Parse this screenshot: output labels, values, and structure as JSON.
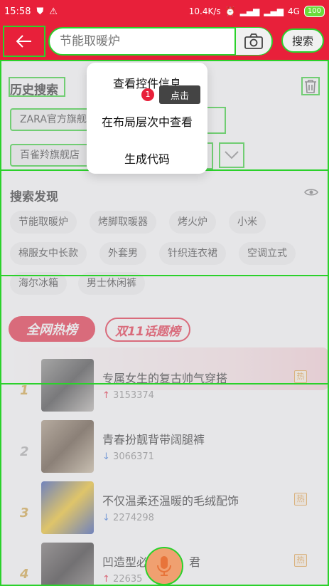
{
  "status": {
    "time": "15:58",
    "network_speed": "10.4K/s",
    "network_type": "4G",
    "battery": "100"
  },
  "header": {
    "search_placeholder": "节能取暖炉",
    "search_button": "搜索"
  },
  "history": {
    "title": "历史搜索",
    "items": [
      "ZARA官方旗舰店",
      "百雀羚旗舰店"
    ]
  },
  "discover": {
    "title": "搜索发现",
    "items": [
      "节能取暖炉",
      "烤脚取暖器",
      "烤火炉",
      "小米",
      "棉服女中长款",
      "外套男",
      "针织连衣裙",
      "空调立式",
      "海尔冰箱",
      "男士休闲裤"
    ]
  },
  "tabs": {
    "hot": "全网热榜",
    "topic": "双11话题榜"
  },
  "rank": [
    {
      "num": "1",
      "title": "专属女生的复古帅气穿搭",
      "count": "3153374",
      "trend": "up",
      "hot": "热"
    },
    {
      "num": "2",
      "title": "青春扮靓背带阔腿裤",
      "count": "3066371",
      "trend": "down",
      "hot": ""
    },
    {
      "num": "3",
      "title": "不仅温柔还温暖的毛绒配饰",
      "count": "2274298",
      "trend": "down",
      "hot": "热"
    },
    {
      "num": "4",
      "title": "凹造型必",
      "title_tail": "君",
      "count": "22635",
      "trend": "up",
      "hot": "热"
    }
  ],
  "popup": {
    "items": [
      "查看控件信息",
      "在布局层次中查看",
      "生成代码"
    ],
    "tip_badge": "1",
    "tip_label": "点击"
  },
  "colors": {
    "brand_red": "#e8203a",
    "highlight_green": "#2bd12b"
  }
}
